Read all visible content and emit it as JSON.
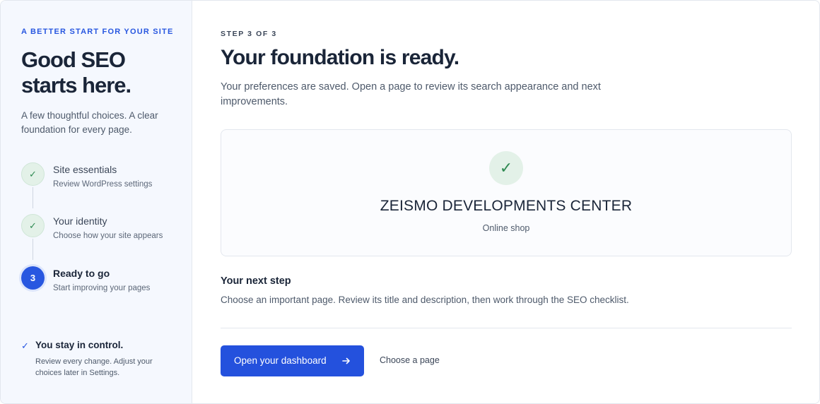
{
  "sidebar": {
    "eyebrow": "A BETTER START FOR YOUR SITE",
    "title": "Good SEO starts here.",
    "description": "A few thoughtful choices. A clear foundation for every page.",
    "steps": [
      {
        "status": "done",
        "marker": "✓",
        "title": "Site essentials",
        "subtitle": "Review WordPress settings"
      },
      {
        "status": "done",
        "marker": "✓",
        "title": "Your identity",
        "subtitle": "Choose how your site appears"
      },
      {
        "status": "active",
        "marker": "3",
        "title": "Ready to go",
        "subtitle": "Start improving your pages"
      }
    ],
    "control": {
      "icon": "✓",
      "title": "You stay in control.",
      "description": "Review every change. Adjust your choices later in Settings."
    }
  },
  "main": {
    "eyebrow": "STEP 3 OF 3",
    "title": "Your foundation is ready.",
    "description": "Your preferences are saved. Open a page to review its search appearance and next improvements.",
    "site": {
      "check_icon": "✓",
      "name": "ZEISMO DEVELOPMENTS CENTER",
      "type": "Online shop"
    },
    "next_step": {
      "title": "Your next step",
      "description": "Choose an important page. Review its title and description, then work through the SEO checklist."
    },
    "actions": {
      "primary_label": "Open your dashboard",
      "secondary_label": "Choose a page"
    }
  },
  "colors": {
    "accent": "#2451dd",
    "success": "#2f8a52",
    "sidebar_bg": "#f5f8fe"
  },
  "icons": {
    "step_done": "check-icon",
    "step_active": "step-number",
    "primary_button": "arrow-right-icon"
  }
}
